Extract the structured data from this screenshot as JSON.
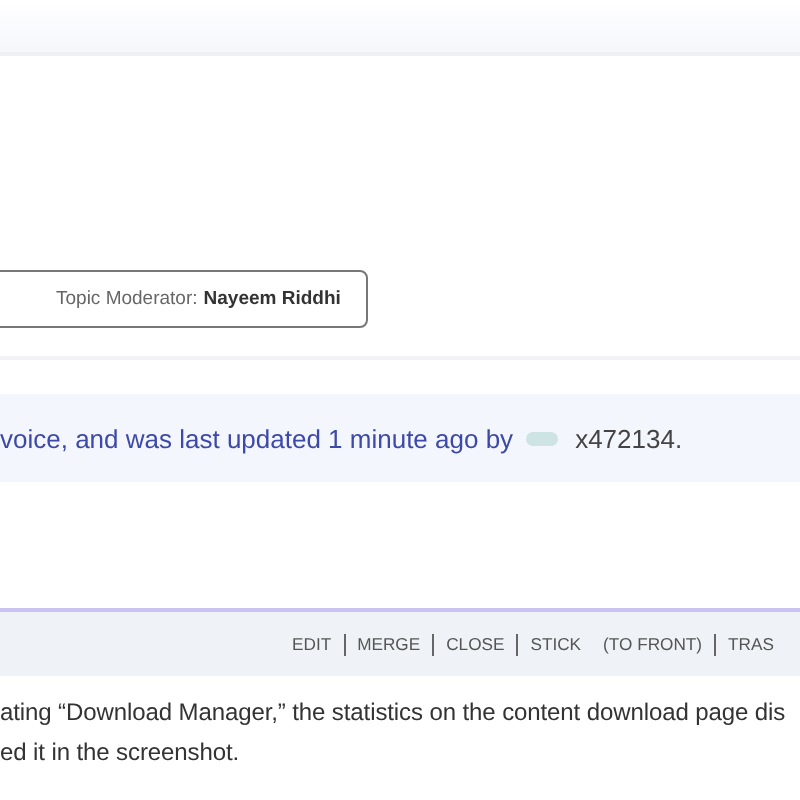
{
  "moderator": {
    "label": "Topic Moderator:",
    "name": "Nayeem Riddhi"
  },
  "topic_info": {
    "text": "voice, and was last updated 1 minute ago by",
    "user": "x472134."
  },
  "actions": [
    "EDIT",
    "MERGE",
    "CLOSE",
    "STICK",
    "(TO FRONT)",
    "TRAS"
  ],
  "post": {
    "text": "ating “Download Manager,” the statistics on the content download page dis\ned it in the screenshot."
  }
}
